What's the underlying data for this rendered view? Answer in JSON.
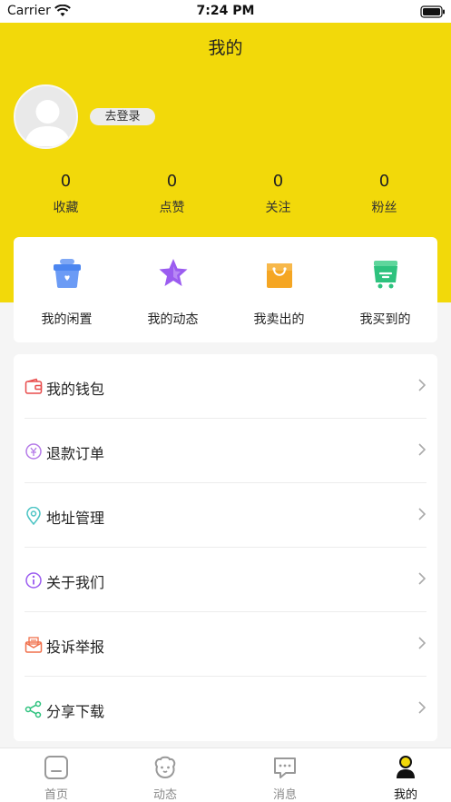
{
  "status_bar": {
    "carrier": "Carrier",
    "time": "7:24 PM"
  },
  "header": {
    "title": "我的",
    "login_label": "去登录"
  },
  "stats": [
    {
      "value": "0",
      "label": "收藏"
    },
    {
      "value": "0",
      "label": "点赞"
    },
    {
      "value": "0",
      "label": "关注"
    },
    {
      "value": "0",
      "label": "粉丝"
    }
  ],
  "quick_actions": [
    {
      "label": "我的闲置",
      "icon": "basket-icon",
      "color": "#4c86f0"
    },
    {
      "label": "我的动态",
      "icon": "star-icon",
      "color": "#9b5cf0"
    },
    {
      "label": "我卖出的",
      "icon": "shopping-bag-icon",
      "color": "#f5a623"
    },
    {
      "label": "我买到的",
      "icon": "cart-icon",
      "color": "#2ec27e"
    }
  ],
  "menu": [
    {
      "label": "我的钱包",
      "icon": "wallet-icon",
      "color": "#e84c4c"
    },
    {
      "label": "退款订单",
      "icon": "refund-icon",
      "color": "#b57be8"
    },
    {
      "label": "地址管理",
      "icon": "location-icon",
      "color": "#4cc4c4"
    },
    {
      "label": "关于我们",
      "icon": "info-icon",
      "color": "#9b5cf0"
    },
    {
      "label": "投诉举报",
      "icon": "report-icon",
      "color": "#f0704c"
    },
    {
      "label": "分享下载",
      "icon": "share-icon",
      "color": "#2ec27e"
    }
  ],
  "tabbar": [
    {
      "label": "首页",
      "icon": "home-icon",
      "active": false
    },
    {
      "label": "动态",
      "icon": "feed-icon",
      "active": false
    },
    {
      "label": "消息",
      "icon": "message-icon",
      "active": false
    },
    {
      "label": "我的",
      "icon": "profile-icon",
      "active": true
    }
  ],
  "colors": {
    "brand_yellow": "#f2d90a",
    "background": "#f5f5f5"
  }
}
